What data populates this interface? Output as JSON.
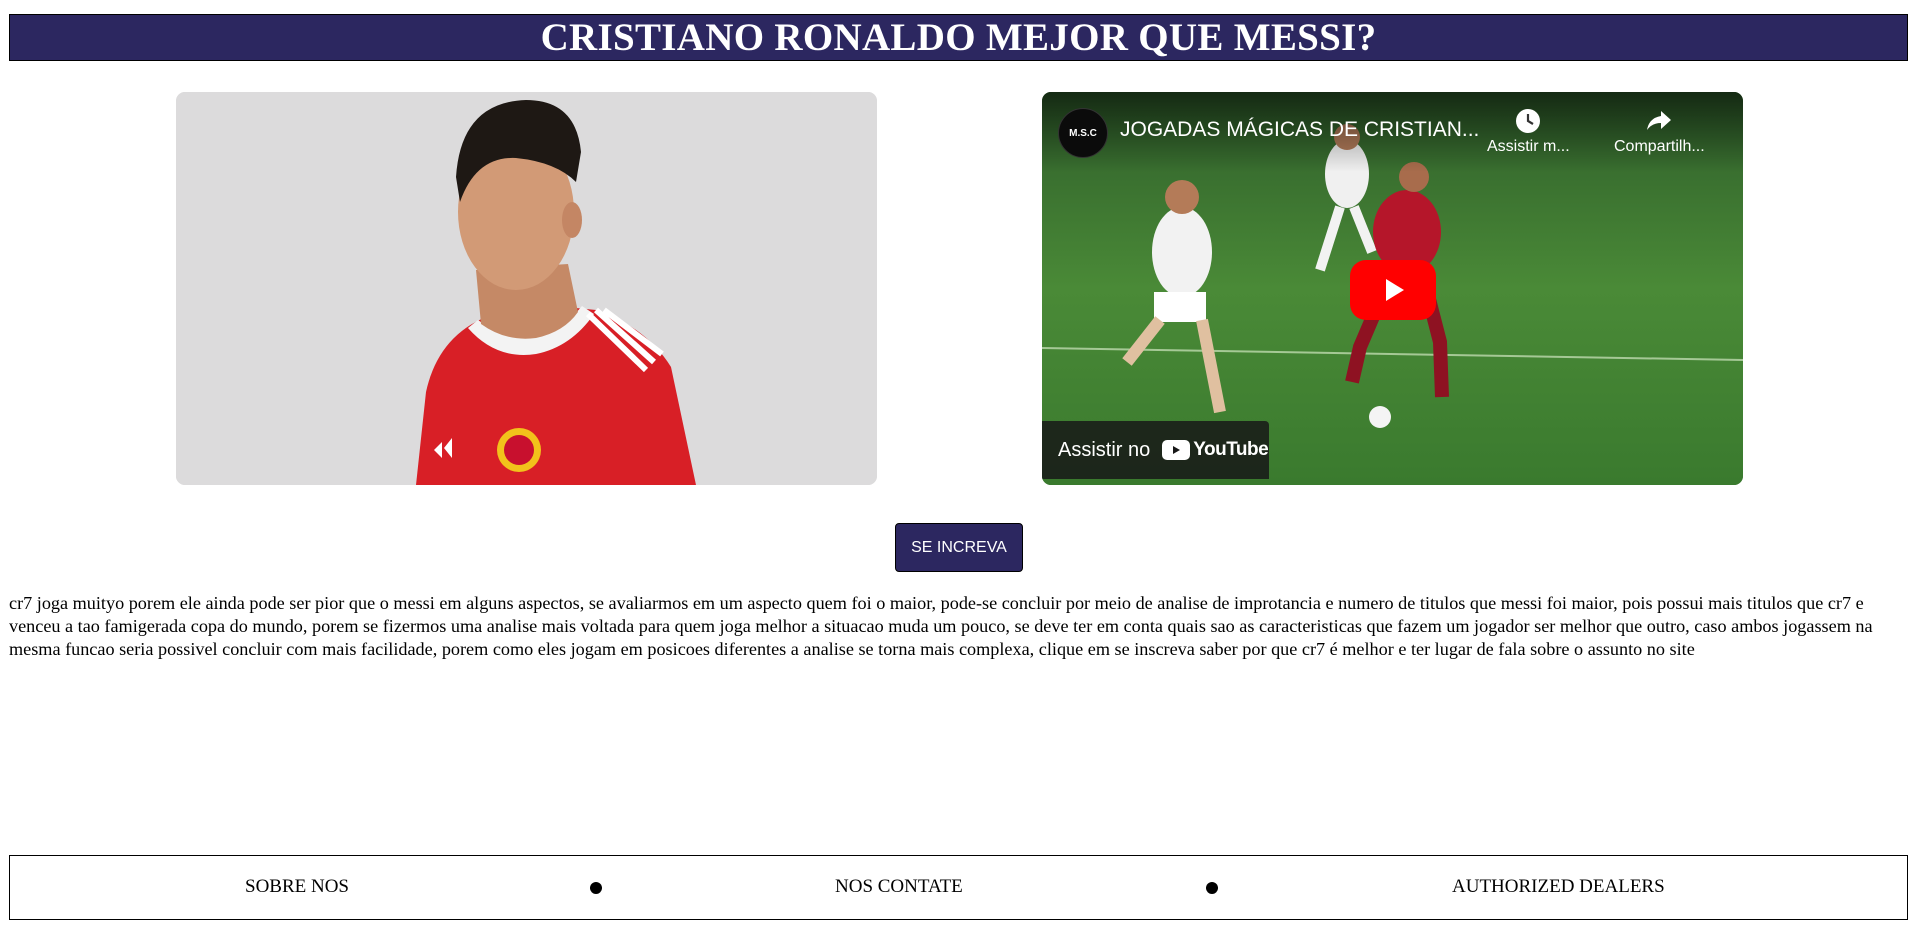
{
  "header": {
    "title": "CRISTIANO RONALDO MEJOR QUE MESSI?"
  },
  "photo": {
    "icon": "player-photo"
  },
  "video": {
    "channel_avatar": "M.S.C",
    "title": "JOGADAS MÁGICAS DE CRISTIAN...",
    "watch_later_label": "Assistir m...",
    "share_label": "Compartilh...",
    "watch_on_label": "Assistir no",
    "brand_label": "YouTube",
    "accent": "#ff0000"
  },
  "subscribe": {
    "label": "SE INCREVA",
    "color": "#2c2760"
  },
  "body": {
    "text": "cr7 joga muityo porem ele ainda pode ser pior que o messi em alguns aspectos, se avaliarmos em um aspecto quem foi o maior, pode-se concluir por meio de analise de improtancia e numero de titulos que messi foi maior, pois possui mais titulos que cr7 e venceu a tao famigerada copa do mundo, porem se fizermos uma analise mais voltada para quem joga melhor a situacao muda um pouco, se deve ter em conta quais sao as caracteristicas que fazem um jogador ser melhor que outro, caso ambos jogassem na mesma funcao seria possivel concluir com mais facilidade, porem como eles jogam em posicoes diferentes a analise se torna mais complexa, clique em se inscreva saber por que cr7 é melhor e ter lugar de fala sobre o assunto no site"
  },
  "footer": {
    "items": [
      "SOBRE NOS",
      "NOS CONTATE",
      "AUTHORIZED DEALERS"
    ]
  }
}
